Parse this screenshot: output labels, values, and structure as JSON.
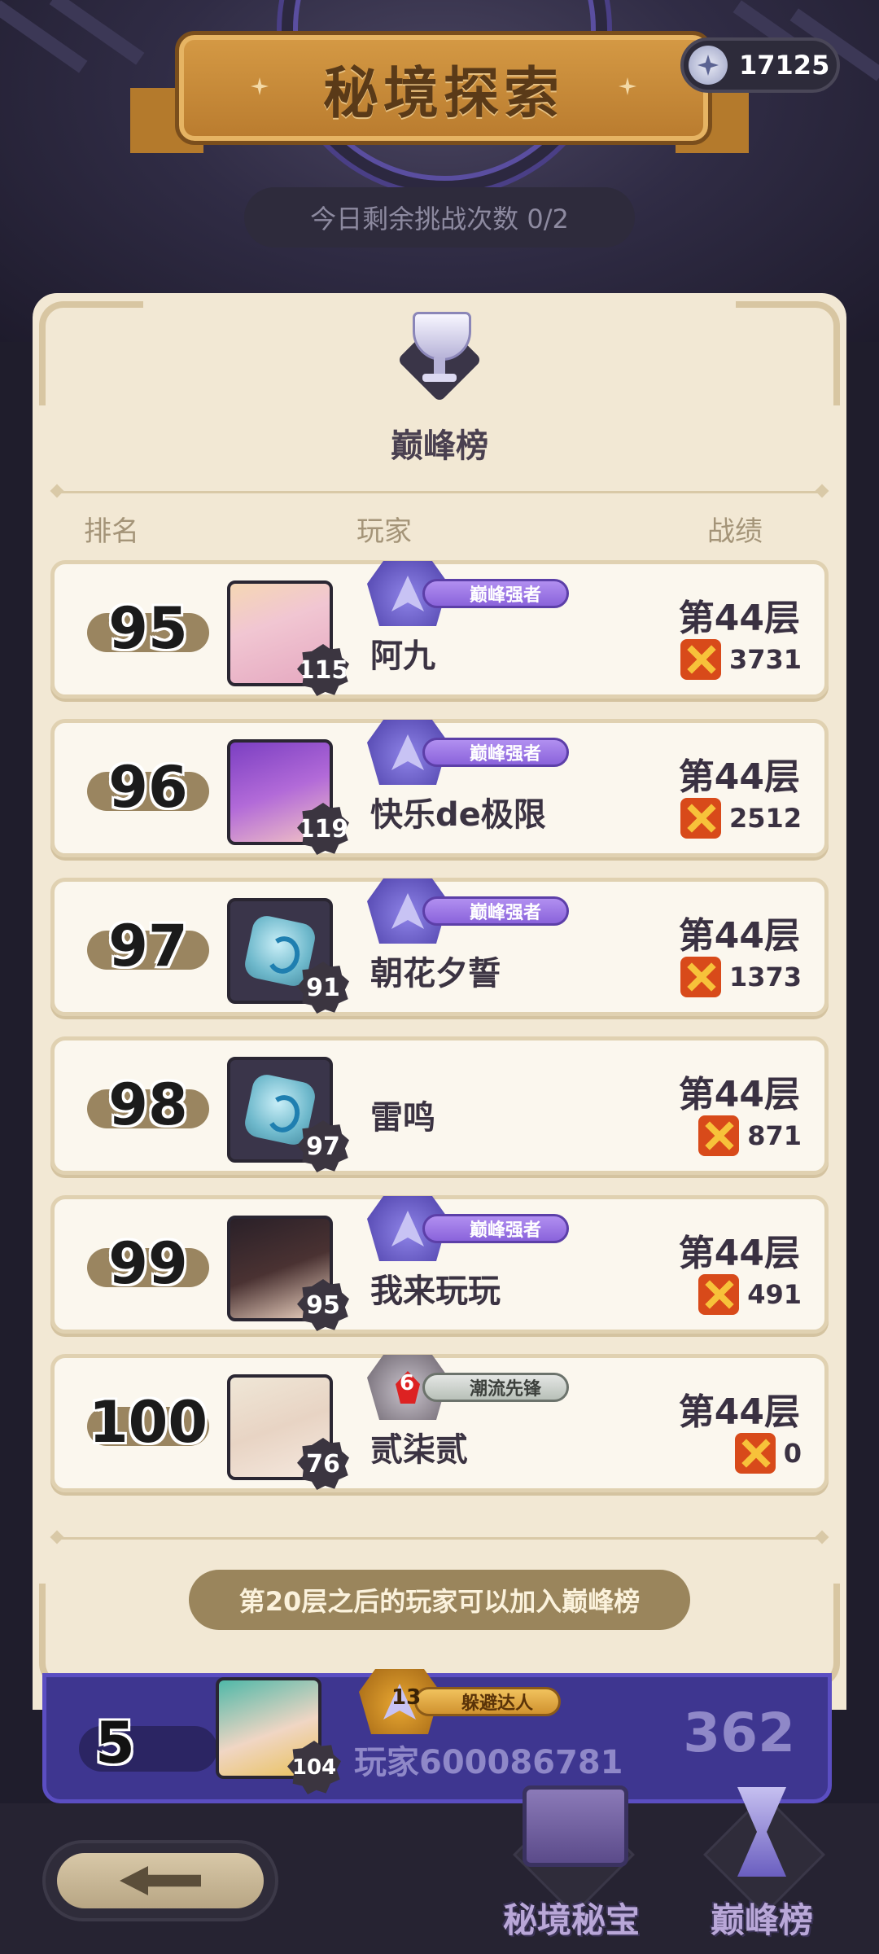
{
  "header": {
    "title": "秘境探索",
    "currency": {
      "icon": "star-crystal-icon",
      "value": "17125"
    },
    "attempts": "今日剩余挑战次数 0/2"
  },
  "board": {
    "title": "巅峰榜",
    "columns": {
      "rank": "排名",
      "player": "玩家",
      "record": "战绩"
    },
    "rows": [
      {
        "rank": "95",
        "level": "115",
        "name": "阿九",
        "badge": "巅峰强者",
        "floor": "第44层",
        "score": "3731"
      },
      {
        "rank": "96",
        "level": "119",
        "name": "快乐de极限",
        "badge": "巅峰强者",
        "floor": "第44层",
        "score": "2512"
      },
      {
        "rank": "97",
        "level": "91",
        "name": "朝花夕誓",
        "badge": "巅峰强者",
        "floor": "第44层",
        "score": "1373"
      },
      {
        "rank": "98",
        "level": "97",
        "name": "雷鸣",
        "badge": "",
        "floor": "第44层",
        "score": "871"
      },
      {
        "rank": "99",
        "level": "95",
        "name": "我来玩玩",
        "badge": "巅峰强者",
        "floor": "第44层",
        "score": "491"
      },
      {
        "rank": "100",
        "level": "76",
        "name": "贰柒贰",
        "badge": "潮流先锋",
        "badge_num": "6",
        "floor": "第44层",
        "score": "0"
      }
    ],
    "hint": "第20层之后的玩家可以加入巅峰榜"
  },
  "self": {
    "rank": "5",
    "level": "104",
    "name": "玩家600086781",
    "badge": "躲避达人",
    "badge_num": "13",
    "score": "362"
  },
  "nav": {
    "treasure": "秘境秘宝",
    "leaderboard": "巅峰榜"
  }
}
